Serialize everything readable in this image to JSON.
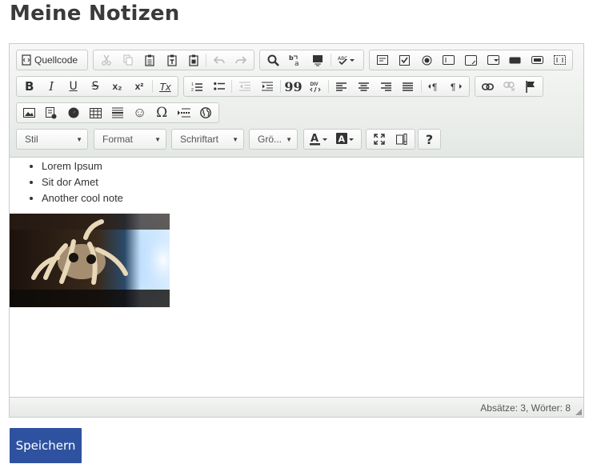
{
  "page": {
    "title": "Meine Notizen"
  },
  "toolbar": {
    "source_label": "Quellcode",
    "combos": {
      "style": "Stil",
      "format": "Format",
      "font": "Schriftart",
      "size": "Grö..."
    },
    "glyphs": {
      "bold": "B",
      "italic": "I",
      "underline": "U",
      "strike": "S",
      "subscript": "x₂",
      "superscript": "x²",
      "remove_format": "Tx",
      "blockquote": "99",
      "help": "?",
      "special_char": "Ω",
      "emoji": "☺"
    }
  },
  "content": {
    "items": [
      "Lorem Ipsum",
      "Sit dor Amet",
      "Another cool note"
    ]
  },
  "status": {
    "text": "Absätze: 3, Wörter: 8"
  },
  "actions": {
    "save_label": "Speichern"
  },
  "colors": {
    "accent": "#2f52a0",
    "toolbar": "#e4e8e4"
  }
}
